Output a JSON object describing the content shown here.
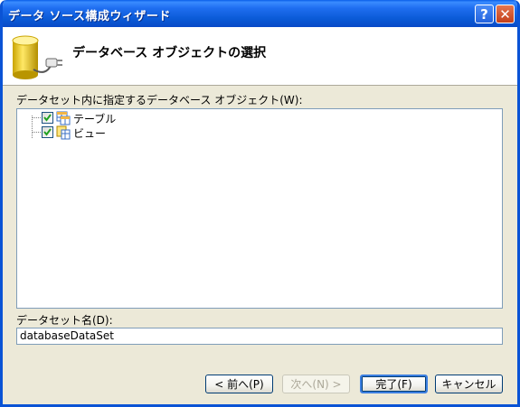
{
  "window": {
    "title": "データ ソース構成ウィザード",
    "help_label": "?",
    "close_label": "✕"
  },
  "header": {
    "heading": "データベース オブジェクトの選択"
  },
  "tree": {
    "label": "データセット内に指定するデータベース オブジェクト(W):",
    "items": [
      {
        "label": "テーブル",
        "checked": true,
        "icon": "table-icon"
      },
      {
        "label": "ビュー",
        "checked": true,
        "icon": "view-icon"
      }
    ]
  },
  "dataset": {
    "label": "データセット名(D):",
    "value": "databaseDataSet"
  },
  "buttons": {
    "back": "< 前へ(P)",
    "next": "次へ(N) >",
    "finish": "完了(F)",
    "cancel": "キャンセル"
  },
  "colors": {
    "titlebar": "#0a5ad6",
    "dialog": "#ece9d8",
    "accent": "#3c7fe1"
  }
}
